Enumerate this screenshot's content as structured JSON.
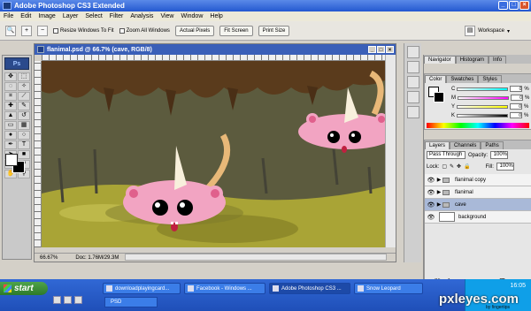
{
  "app": {
    "title": "Adobe Photoshop CS3 Extended",
    "workspace": "Workspace"
  },
  "menu": [
    "File",
    "Edit",
    "Image",
    "Layer",
    "Select",
    "Filter",
    "Analysis",
    "View",
    "Window",
    "Help"
  ],
  "options": {
    "resize_windows": "Resize Windows To Fit",
    "zoom_all": "Zoom All Windows",
    "actual_pixels": "Actual Pixels",
    "fit_screen": "Fit Screen",
    "print_size": "Print Size"
  },
  "toolbox": {
    "logo": "Ps"
  },
  "document": {
    "title": "flanimal.psd @ 66.7% (cave, RGB/8)",
    "zoom": "66.67%",
    "doc_size": "Doc: 1.76M/29.3M"
  },
  "panels": {
    "nav_tabs": [
      "Navigator",
      "Histogram",
      "Info"
    ],
    "color_tabs": [
      "Color",
      "Swatches",
      "Styles"
    ],
    "color_rows": [
      {
        "label": "C",
        "value": "0",
        "unit": "%"
      },
      {
        "label": "M",
        "value": "0",
        "unit": "%"
      },
      {
        "label": "Y",
        "value": "0",
        "unit": "%"
      },
      {
        "label": "K",
        "value": "0",
        "unit": "%"
      }
    ],
    "layer_tabs": [
      "Layers",
      "Channels",
      "Paths"
    ],
    "blend_mode": "Pass Through",
    "opacity_label": "Opacity:",
    "opacity_value": "100%",
    "lock_label": "Lock:",
    "fill_label": "Fill:",
    "fill_value": "100%",
    "layers": [
      {
        "name": "flanimal copy",
        "type": "group",
        "selected": false
      },
      {
        "name": "flanimal",
        "type": "group",
        "selected": false
      },
      {
        "name": "cave",
        "type": "group",
        "selected": true
      },
      {
        "name": "background",
        "type": "layer",
        "selected": false
      }
    ]
  },
  "taskbar": {
    "start": "start",
    "tasks": [
      {
        "label": "downloadplayingcard..."
      },
      {
        "label": "Facebook - Windows ..."
      },
      {
        "label": "Adobe Photoshop CS3 ..."
      },
      {
        "label": "Snow Leopard"
      }
    ],
    "folder": "PSD",
    "clock": "16:05"
  },
  "watermark": {
    "text": "pxleyes.com",
    "sub": "by fingertips"
  },
  "colors": {
    "title_bar": "#2458d0",
    "cave_wall": "#5c5b3e",
    "cave_floor": "#a9a436",
    "creature": "#f2a4c2",
    "brown": "#5a3b1c"
  }
}
